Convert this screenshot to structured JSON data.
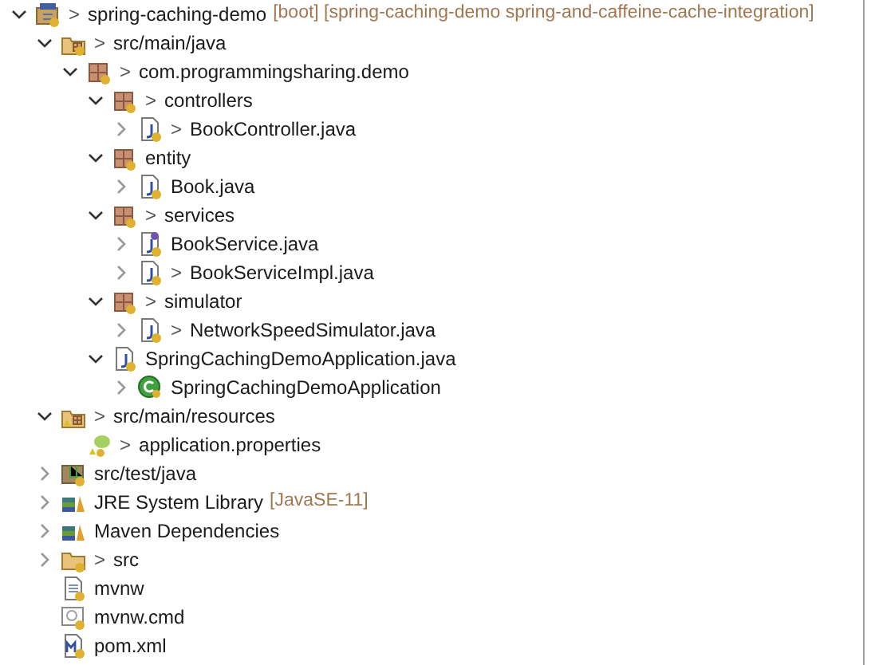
{
  "tree": [
    {
      "kind": "project",
      "marker": ">",
      "label": "spring-caching-demo",
      "decoration": "[boot] [spring-caching-demo spring-and-caffeine-cache-integration]",
      "expanded": true,
      "children": [
        {
          "kind": "source-folder",
          "marker": ">",
          "label": "src/main/java",
          "expanded": true,
          "children": [
            {
              "kind": "package",
              "marker": ">",
              "label": "com.programmingsharing.demo",
              "expanded": true,
              "children": [
                {
                  "kind": "package",
                  "marker": ">",
                  "label": "controllers",
                  "expanded": true,
                  "children": [
                    {
                      "kind": "java-file",
                      "marker": ">",
                      "label": "BookController.java",
                      "expanded": false
                    }
                  ]
                },
                {
                  "kind": "package",
                  "label": "entity",
                  "expanded": true,
                  "children": [
                    {
                      "kind": "java-file",
                      "label": "Book.java",
                      "expanded": false
                    }
                  ]
                },
                {
                  "kind": "package",
                  "marker": ">",
                  "label": "services",
                  "expanded": true,
                  "children": [
                    {
                      "kind": "interface-file",
                      "label": "BookService.java",
                      "expanded": false
                    },
                    {
                      "kind": "java-file",
                      "marker": ">",
                      "label": "BookServiceImpl.java",
                      "expanded": false
                    }
                  ]
                },
                {
                  "kind": "package",
                  "marker": ">",
                  "label": "simulator",
                  "expanded": true,
                  "children": [
                    {
                      "kind": "java-file",
                      "marker": ">",
                      "label": "NetworkSpeedSimulator.java",
                      "expanded": false
                    }
                  ]
                },
                {
                  "kind": "java-file",
                  "label": "SpringCachingDemoApplication.java",
                  "expanded": true,
                  "children": [
                    {
                      "kind": "class",
                      "label": "SpringCachingDemoApplication",
                      "expanded": false
                    }
                  ]
                }
              ]
            }
          ]
        },
        {
          "kind": "resources-folder",
          "marker": ">",
          "label": "src/main/resources",
          "expanded": true,
          "children": [
            {
              "kind": "properties-file",
              "marker": ">",
              "label": "application.properties"
            }
          ]
        },
        {
          "kind": "test-folder",
          "label": "src/test/java",
          "expanded": false
        },
        {
          "kind": "library",
          "label": "JRE System Library",
          "decoration": "[JavaSE-11]",
          "expanded": false
        },
        {
          "kind": "library",
          "label": "Maven Dependencies",
          "expanded": false
        },
        {
          "kind": "folder",
          "marker": ">",
          "label": "src",
          "expanded": false
        },
        {
          "kind": "text-file",
          "label": "mvnw"
        },
        {
          "kind": "script-file",
          "label": "mvnw.cmd"
        },
        {
          "kind": "xml-file",
          "label": "pom.xml"
        }
      ]
    }
  ]
}
